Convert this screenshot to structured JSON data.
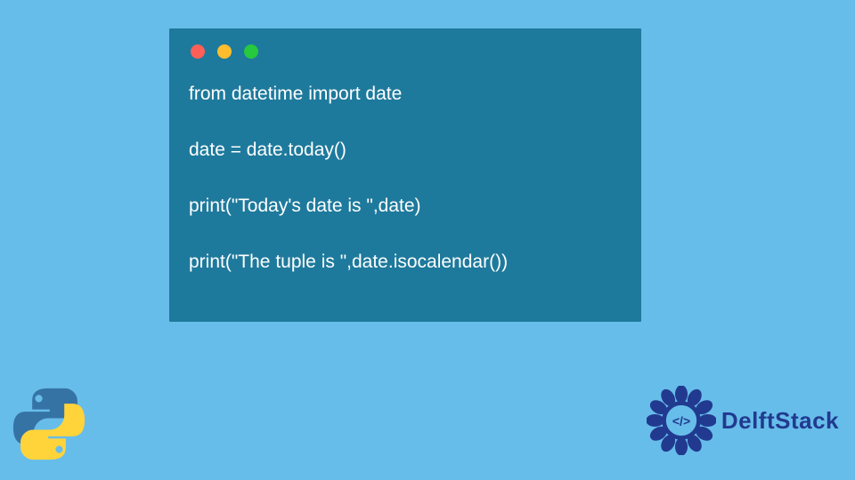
{
  "window": {
    "buttons": [
      "close",
      "minimize",
      "maximize"
    ]
  },
  "code": {
    "lines": [
      "from datetime import date",
      "",
      "date = date.today()",
      "",
      "print(\"Today's date is \",date)",
      "",
      "print(\"The tuple is \",date.isocalendar())"
    ]
  },
  "brand": {
    "name": "DelftStack",
    "badge_symbol": "</>"
  },
  "corner_icon": "python-logo"
}
